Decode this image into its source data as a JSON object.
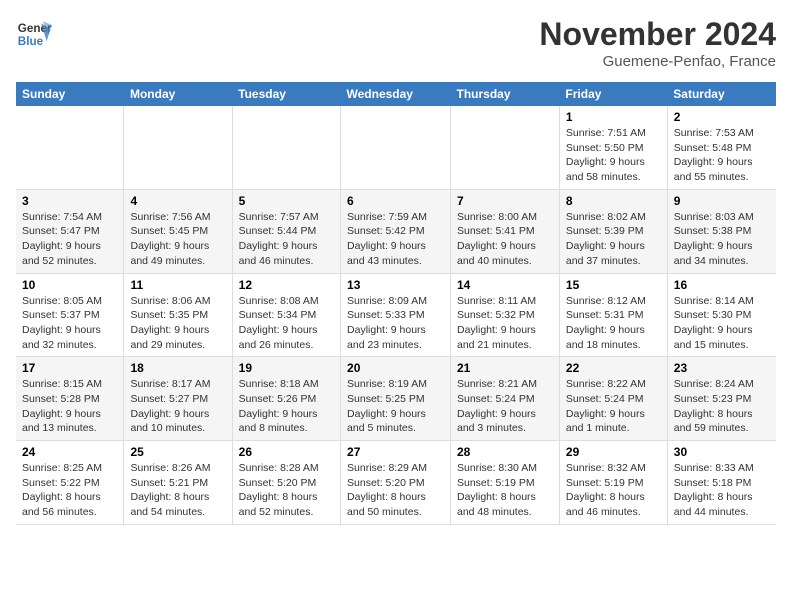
{
  "logo": {
    "line1": "General",
    "line2": "Blue"
  },
  "title": "November 2024",
  "subtitle": "Guemene-Penfao, France",
  "weekdays": [
    "Sunday",
    "Monday",
    "Tuesday",
    "Wednesday",
    "Thursday",
    "Friday",
    "Saturday"
  ],
  "weeks": [
    [
      {
        "day": "",
        "info": ""
      },
      {
        "day": "",
        "info": ""
      },
      {
        "day": "",
        "info": ""
      },
      {
        "day": "",
        "info": ""
      },
      {
        "day": "",
        "info": ""
      },
      {
        "day": "1",
        "info": "Sunrise: 7:51 AM\nSunset: 5:50 PM\nDaylight: 9 hours and 58 minutes."
      },
      {
        "day": "2",
        "info": "Sunrise: 7:53 AM\nSunset: 5:48 PM\nDaylight: 9 hours and 55 minutes."
      }
    ],
    [
      {
        "day": "3",
        "info": "Sunrise: 7:54 AM\nSunset: 5:47 PM\nDaylight: 9 hours and 52 minutes."
      },
      {
        "day": "4",
        "info": "Sunrise: 7:56 AM\nSunset: 5:45 PM\nDaylight: 9 hours and 49 minutes."
      },
      {
        "day": "5",
        "info": "Sunrise: 7:57 AM\nSunset: 5:44 PM\nDaylight: 9 hours and 46 minutes."
      },
      {
        "day": "6",
        "info": "Sunrise: 7:59 AM\nSunset: 5:42 PM\nDaylight: 9 hours and 43 minutes."
      },
      {
        "day": "7",
        "info": "Sunrise: 8:00 AM\nSunset: 5:41 PM\nDaylight: 9 hours and 40 minutes."
      },
      {
        "day": "8",
        "info": "Sunrise: 8:02 AM\nSunset: 5:39 PM\nDaylight: 9 hours and 37 minutes."
      },
      {
        "day": "9",
        "info": "Sunrise: 8:03 AM\nSunset: 5:38 PM\nDaylight: 9 hours and 34 minutes."
      }
    ],
    [
      {
        "day": "10",
        "info": "Sunrise: 8:05 AM\nSunset: 5:37 PM\nDaylight: 9 hours and 32 minutes."
      },
      {
        "day": "11",
        "info": "Sunrise: 8:06 AM\nSunset: 5:35 PM\nDaylight: 9 hours and 29 minutes."
      },
      {
        "day": "12",
        "info": "Sunrise: 8:08 AM\nSunset: 5:34 PM\nDaylight: 9 hours and 26 minutes."
      },
      {
        "day": "13",
        "info": "Sunrise: 8:09 AM\nSunset: 5:33 PM\nDaylight: 9 hours and 23 minutes."
      },
      {
        "day": "14",
        "info": "Sunrise: 8:11 AM\nSunset: 5:32 PM\nDaylight: 9 hours and 21 minutes."
      },
      {
        "day": "15",
        "info": "Sunrise: 8:12 AM\nSunset: 5:31 PM\nDaylight: 9 hours and 18 minutes."
      },
      {
        "day": "16",
        "info": "Sunrise: 8:14 AM\nSunset: 5:30 PM\nDaylight: 9 hours and 15 minutes."
      }
    ],
    [
      {
        "day": "17",
        "info": "Sunrise: 8:15 AM\nSunset: 5:28 PM\nDaylight: 9 hours and 13 minutes."
      },
      {
        "day": "18",
        "info": "Sunrise: 8:17 AM\nSunset: 5:27 PM\nDaylight: 9 hours and 10 minutes."
      },
      {
        "day": "19",
        "info": "Sunrise: 8:18 AM\nSunset: 5:26 PM\nDaylight: 9 hours and 8 minutes."
      },
      {
        "day": "20",
        "info": "Sunrise: 8:19 AM\nSunset: 5:25 PM\nDaylight: 9 hours and 5 minutes."
      },
      {
        "day": "21",
        "info": "Sunrise: 8:21 AM\nSunset: 5:24 PM\nDaylight: 9 hours and 3 minutes."
      },
      {
        "day": "22",
        "info": "Sunrise: 8:22 AM\nSunset: 5:24 PM\nDaylight: 9 hours and 1 minute."
      },
      {
        "day": "23",
        "info": "Sunrise: 8:24 AM\nSunset: 5:23 PM\nDaylight: 8 hours and 59 minutes."
      }
    ],
    [
      {
        "day": "24",
        "info": "Sunrise: 8:25 AM\nSunset: 5:22 PM\nDaylight: 8 hours and 56 minutes."
      },
      {
        "day": "25",
        "info": "Sunrise: 8:26 AM\nSunset: 5:21 PM\nDaylight: 8 hours and 54 minutes."
      },
      {
        "day": "26",
        "info": "Sunrise: 8:28 AM\nSunset: 5:20 PM\nDaylight: 8 hours and 52 minutes."
      },
      {
        "day": "27",
        "info": "Sunrise: 8:29 AM\nSunset: 5:20 PM\nDaylight: 8 hours and 50 minutes."
      },
      {
        "day": "28",
        "info": "Sunrise: 8:30 AM\nSunset: 5:19 PM\nDaylight: 8 hours and 48 minutes."
      },
      {
        "day": "29",
        "info": "Sunrise: 8:32 AM\nSunset: 5:19 PM\nDaylight: 8 hours and 46 minutes."
      },
      {
        "day": "30",
        "info": "Sunrise: 8:33 AM\nSunset: 5:18 PM\nDaylight: 8 hours and 44 minutes."
      }
    ]
  ]
}
